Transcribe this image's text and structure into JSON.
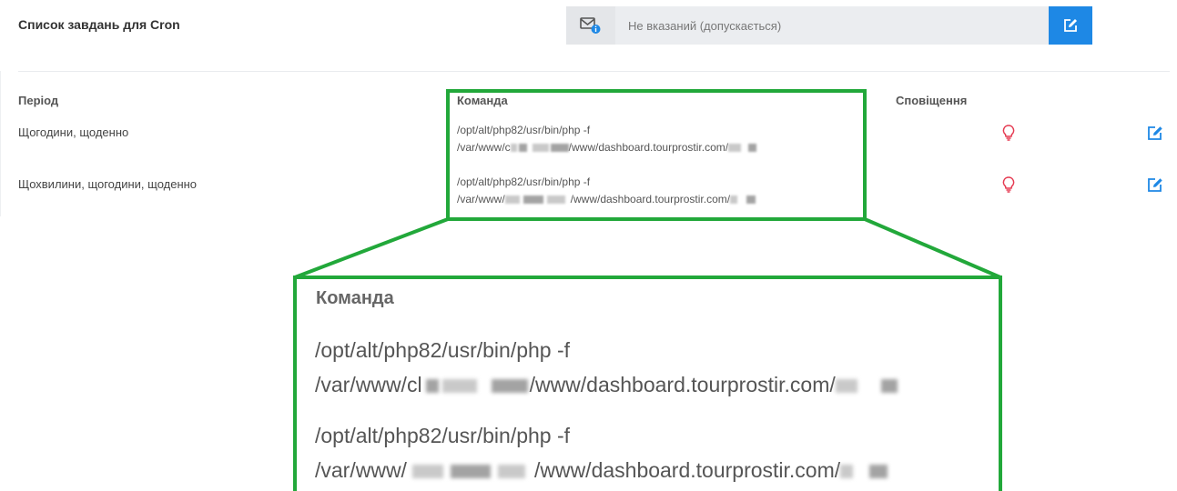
{
  "header": {
    "title": "Список завдань для Cron",
    "email_placeholder": "Не вказаний (допускається)"
  },
  "table": {
    "columns": {
      "period": "Період",
      "command": "Команда",
      "notify": "Сповіщення"
    },
    "rows": [
      {
        "period": "Щогодини, щоденно",
        "cmd_line1": "/opt/alt/php82/usr/bin/php -f",
        "cmd_line2_prefix": "/var/www/c",
        "cmd_line2_middle": "/www/dashboard.tourprostir.com/"
      },
      {
        "period": "Щохвилини, щогодини, щоденно",
        "cmd_line1": "/opt/alt/php82/usr/bin/php -f",
        "cmd_line2_prefix": "/var/www/",
        "cmd_line2_middle": "/www/dashboard.tourprostir.com/"
      }
    ]
  },
  "zoom": {
    "title": "Команда",
    "rows": [
      {
        "line1": "/opt/alt/php82/usr/bin/php -f",
        "prefix": "/var/www/cl",
        "middle": "/www/dashboard.tourprostir.com/"
      },
      {
        "line1": "/opt/alt/php82/usr/bin/php -f",
        "prefix": "/var/www/",
        "middle": "/www/dashboard.tourprostir.com/"
      }
    ]
  },
  "colors": {
    "accent": "#1e88e5",
    "highlight": "#22a83a",
    "bulb": "#e53950"
  }
}
